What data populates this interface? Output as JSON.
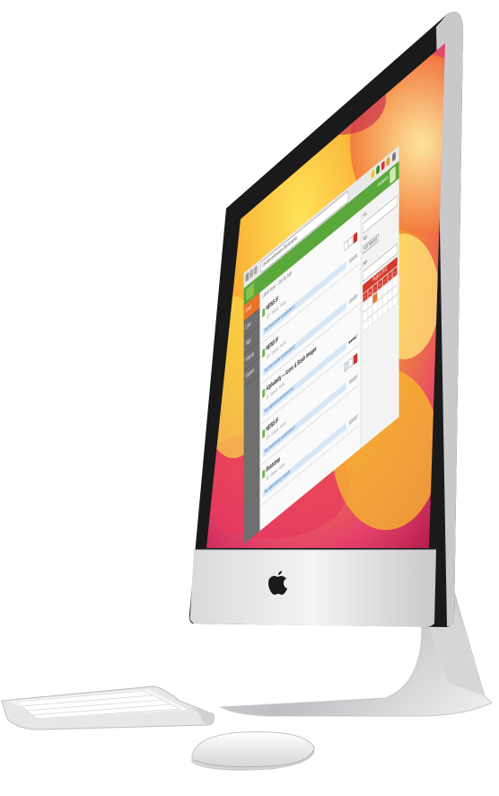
{
  "browser": {
    "url": "chrome-extension://bookmarks",
    "toolbar_icons": [
      "back-icon",
      "forward-icon",
      "reload-icon",
      "star-icon",
      "extension-icon",
      "menu-icon"
    ]
  },
  "app": {
    "header_user": "Frederick",
    "sidebar": [
      {
        "label": "Feed",
        "active": true
      },
      {
        "label": "Lists",
        "active": false
      },
      {
        "label": "Tags",
        "active": false
      },
      {
        "label": "Friends",
        "active": false
      },
      {
        "label": "Explore",
        "active": false
      }
    ],
    "topline": "Latest items · Sort by date",
    "feed": [
      {
        "title": "NEWS IF",
        "sub": "123 · Shared · Public",
        "link": "http://bookmarks.example/item/1",
        "rating": "✩✩✩✩✩"
      },
      {
        "title": "NEWS IF",
        "sub": "123 · Shared · Public",
        "link": "http://bookmarks.example/item/2",
        "rating": "✩✩✩✩✩"
      },
      {
        "title": "Alphabetly — Icons & Stock Images",
        "sub": "23 · Shared · Public",
        "link": "http://alphabetly.example/icons",
        "rating": "★★★★✩"
      },
      {
        "title": "NEWS IF",
        "sub": "123 · Shared · Public",
        "link": "http://bookmarks.example/item/3",
        "rating": "✩✩✩✩✩"
      },
      {
        "title": "Bootstrap",
        "sub": "56 · Shared · Public",
        "link": "http://getbootstrap.example",
        "rating": "✩✩✩✩✩"
      }
    ],
    "right": {
      "search_label": "Title",
      "tags_label": "Tags",
      "add_button": "Add Selected",
      "date_label": "Date",
      "calendar_title": "August 2012",
      "weekdays": [
        "S",
        "M",
        "T",
        "W",
        "T",
        "F",
        "S"
      ]
    }
  },
  "colors": {
    "accent_green": "#5aa83c",
    "sidebar_active": "#e8742b",
    "calendar_red": "#d6392b"
  }
}
